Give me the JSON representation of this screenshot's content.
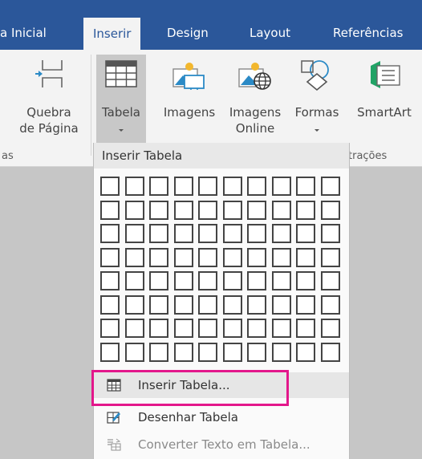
{
  "tabs": [
    "a Inicial",
    "Inserir",
    "Design",
    "Layout",
    "Referências"
  ],
  "ribbon": {
    "quebra_line1": "Quebra",
    "quebra_line2": "de Página",
    "tabela": "Tabela",
    "imagens": "Imagens",
    "imagens_online_line1": "Imagens",
    "imagens_online_line2": "Online",
    "formas": "Formas",
    "smartart": "SmartArt",
    "group_left": "as",
    "group_right": "trações"
  },
  "dropdown": {
    "header": "Inserir Tabela",
    "grid_cols": 10,
    "grid_rows": 8,
    "items": [
      "Inserir Tabela...",
      "Desenhar Tabela",
      "Converter Texto em Tabela..."
    ]
  },
  "colors": {
    "accent": "#2b579a",
    "highlight": "#e3178b"
  }
}
